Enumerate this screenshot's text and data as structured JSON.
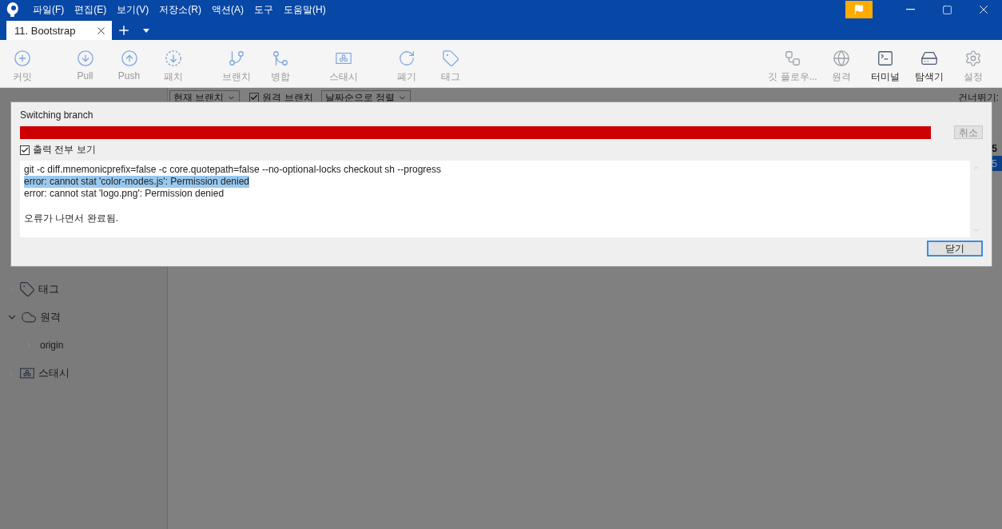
{
  "menu": [
    "파일(F)",
    "편집(E)",
    "보기(V)",
    "저장소(R)",
    "액션(A)",
    "도구",
    "도움말(H)"
  ],
  "tabs": [
    {
      "label": "11. Bootstrap",
      "selected": true
    }
  ],
  "toolbar": {
    "left": [
      [
        {
          "label": "커밋",
          "kind": "commit"
        }
      ],
      [
        {
          "label": "Pull",
          "kind": "pull"
        },
        {
          "label": "Push",
          "kind": "push"
        },
        {
          "label": "패치",
          "kind": "fetch"
        }
      ],
      [
        {
          "label": "브랜치",
          "kind": "branch"
        },
        {
          "label": "병합",
          "kind": "merge"
        }
      ],
      [
        {
          "label": "스태시",
          "kind": "stash"
        }
      ],
      [
        {
          "label": "폐기",
          "kind": "discard"
        },
        {
          "label": "태그",
          "kind": "tag"
        }
      ]
    ],
    "right": [
      {
        "label": "깃 플로우...",
        "kind": "flow",
        "active": false
      },
      {
        "label": "원격",
        "kind": "globe",
        "active": false
      },
      {
        "label": "터미널",
        "kind": "terminal",
        "active": true
      },
      {
        "label": "탐색기",
        "kind": "explorer",
        "active": true
      },
      {
        "label": "설정",
        "kind": "settings",
        "active": false
      }
    ]
  },
  "filter_bar": {
    "branch_dropdown": "현재 브랜치",
    "remote_branches": {
      "label": "원격 브랜치",
      "checked": true
    },
    "sort_dropdown": "날짜순으로 정렬",
    "jump_label": "건너뛰기:"
  },
  "commits": [
    {
      "column_1": "5",
      "selected": false
    },
    {
      "column_1": "5",
      "selected": true
    }
  ],
  "sidebar": [
    {
      "label": "태그",
      "kind": "tag",
      "expanded": false
    },
    {
      "label": "원격",
      "kind": "cloud",
      "expanded": true,
      "children": [
        {
          "label": "origin",
          "expanded": false
        }
      ]
    },
    {
      "label": "스태시",
      "kind": "stash",
      "expanded": false
    }
  ],
  "dialog": {
    "title": "Switching branch",
    "progress": {
      "level": 1
    },
    "cancel": {
      "label": "취소",
      "disabled": true
    },
    "show_output": {
      "label": "출력 전부 보기",
      "checked": true
    },
    "output": [
      {
        "text": "git -c diff.mnemonicprefix=false -c core.quotepath=false --no-optional-locks checkout sh --progress",
        "selected": false
      },
      {
        "text": "error: cannot stat 'color-modes.js': Permission denied",
        "selected": true
      },
      {
        "text": "error: cannot stat 'logo.png': Permission denied",
        "selected": false
      }
    ],
    "result": "오류가 나면서 완료됨.",
    "close": {
      "label": "닫기",
      "focused": true
    }
  }
}
